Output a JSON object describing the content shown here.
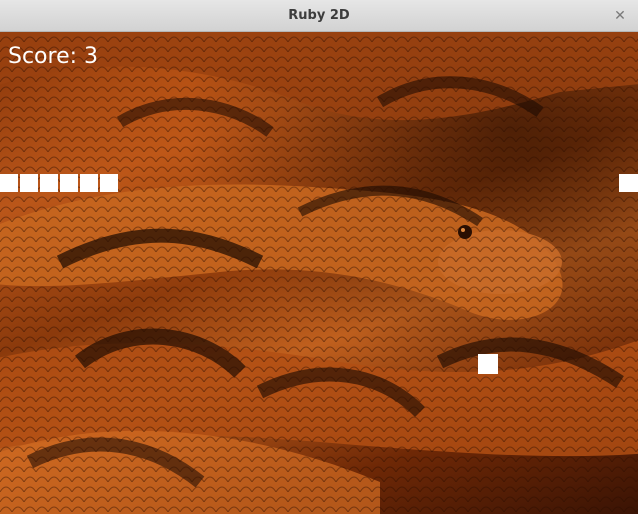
{
  "window": {
    "title": "Ruby 2D",
    "close_glyph": "✕"
  },
  "game": {
    "score_label": "Score: 3",
    "score": 3,
    "snake_color": "#ffffff",
    "food_color": "#ffffff",
    "background": "python-skin-image"
  }
}
